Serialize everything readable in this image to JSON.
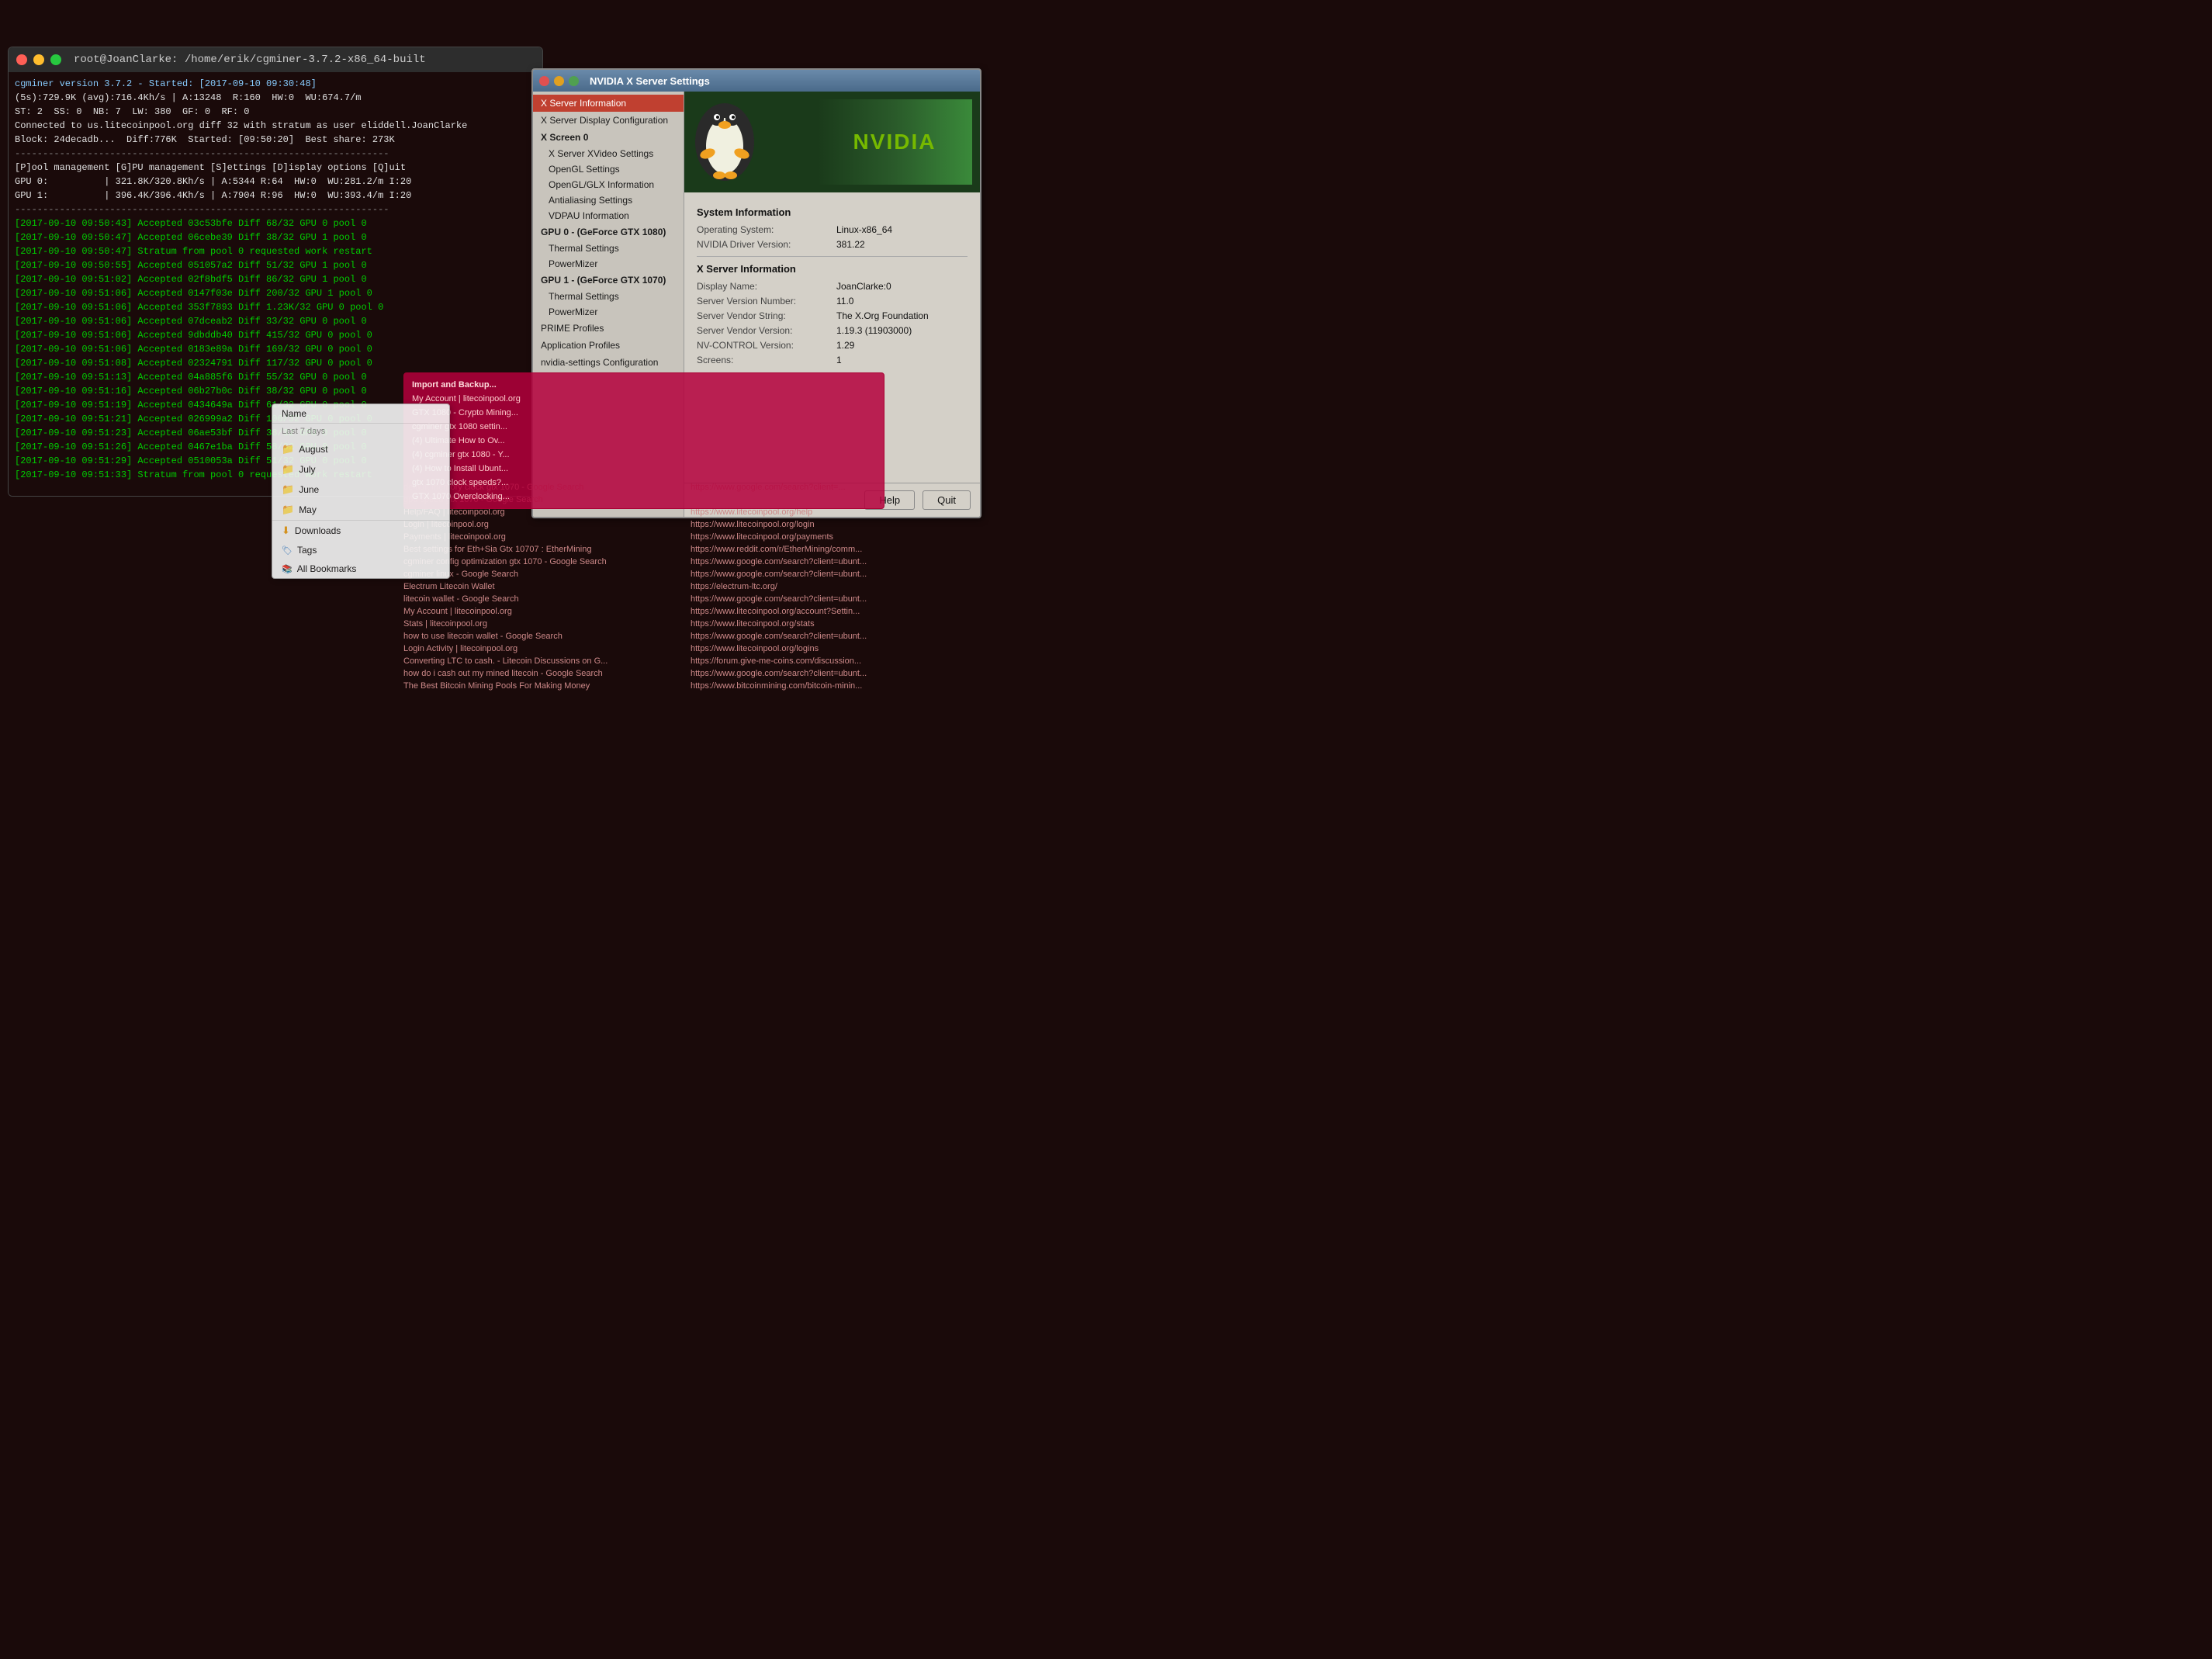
{
  "desktop": {
    "bg_color": "#1a0a0a"
  },
  "terminal": {
    "title": "root@JoanClarke: /home/erik/cgminer-3.7.2-x86_64-built",
    "lines": [
      "cgminer version 3.7.2 - Started: [2017-09-10 09:30:48]",
      "(5s):729.9K (avg):716.4Kh/s | A:13248  R:160  HW:0  WU:674.7/m",
      "ST: 2  SS: 0  NB: 7  LW: 380  GF: 0  RF: 0",
      "Connected to us.litecoinpool.org diff 32 with stratum as user eliddell.JoanClarke",
      "Block: 24decadb...  Diff:776K  Started: [09:50:20]  Best share: 273K",
      "-------------------------------------------------------------------",
      "[P]ool management [G]PU management [S]ettings [D]isplay options [Q]uit",
      "GPU 0:          | 321.8K/320.8Kh/s | A:5344 R:64  HW:0  WU:281.2/m I:20",
      "GPU 1:          | 396.4K/396.4Kh/s | A:7904 R:96  HW:0  WU:393.4/m I:20",
      "-------------------------------------------------------------------",
      "[2017-09-10 09:50:43] Accepted 03c53bfe Diff 68/32 GPU 0 pool 0",
      "[2017-09-10 09:50:47] Accepted 06cebe39 Diff 38/32 GPU 1 pool 0",
      "[2017-09-10 09:50:47] Stratum from pool 0 requested work restart",
      "[2017-09-10 09:50:55] Accepted 051057a2 Diff 51/32 GPU 1 pool 0",
      "[2017-09-10 09:51:02] Accepted 02f8bdf5 Diff 86/32 GPU 1 pool 0",
      "[2017-09-10 09:51:06] Accepted 0147f03e Diff 200/32 GPU 1 pool 0",
      "[2017-09-10 09:51:06] Accepted 353f7893 Diff 1.23K/32 GPU 0 pool 0",
      "[2017-09-10 09:51:06] Accepted 07dceab2 Diff 33/32 GPU 0 pool 0",
      "[2017-09-10 09:51:06] Accepted 9dbddb40 Diff 415/32 GPU 0 pool 0",
      "[2017-09-10 09:51:06] Accepted 0183e89a Diff 169/32 GPU 0 pool 0",
      "[2017-09-10 09:51:08] Accepted 02324791 Diff 117/32 GPU 0 pool 0",
      "[2017-09-10 09:51:13] Accepted 04a885f6 Diff 55/32 GPU 0 pool 0",
      "[2017-09-10 09:51:16] Accepted 06b27b0c Diff 38/32 GPU 0 pool 0",
      "[2017-09-10 09:51:19] Accepted 0434649a Diff 61/32 GPU 0 pool 0",
      "[2017-09-10 09:51:21] Accepted 026999a2 Diff 106/32 GPU 0 pool 0",
      "[2017-09-10 09:51:23] Accepted 06ae53bf Diff 38/32 GPU 0 pool 0",
      "[2017-09-10 09:51:26] Accepted 0467e1ba Diff 58/32 GPU 0 pool 0",
      "[2017-09-10 09:51:29] Accepted 0510053a Diff 51/32 GPU 0 pool 0",
      "[2017-09-10 09:51:33] Stratum from pool 0 requested work restart"
    ]
  },
  "nvidia_window": {
    "title": "NVIDIA X Server Settings",
    "sidebar": {
      "items": [
        {
          "id": "x-server-info",
          "label": "X Server Information",
          "active": true,
          "indent": 0
        },
        {
          "id": "x-server-display",
          "label": "X Server Display Configuration",
          "active": false,
          "indent": 0
        },
        {
          "id": "x-screen-0",
          "label": "X Screen 0",
          "active": false,
          "indent": 0
        },
        {
          "id": "x-video-settings",
          "label": "X Server XVideo Settings",
          "active": false,
          "indent": 1
        },
        {
          "id": "opengl-settings",
          "label": "OpenGL Settings",
          "active": false,
          "indent": 1
        },
        {
          "id": "opengl-glx-info",
          "label": "OpenGL/GLX Information",
          "active": false,
          "indent": 1
        },
        {
          "id": "antialiasing",
          "label": "Antialiasing Settings",
          "active": false,
          "indent": 1
        },
        {
          "id": "vdpau-info",
          "label": "VDPAU Information",
          "active": false,
          "indent": 1
        },
        {
          "id": "gpu0-section",
          "label": "GPU 0 - (GeForce GTX 1080)",
          "active": false,
          "indent": 0
        },
        {
          "id": "gpu0-thermal",
          "label": "Thermal Settings",
          "active": false,
          "indent": 1
        },
        {
          "id": "gpu0-powermizer",
          "label": "PowerMizer",
          "active": false,
          "indent": 1
        },
        {
          "id": "gpu1-section",
          "label": "GPU 1 - (GeForce GTX 1070)",
          "active": false,
          "indent": 0
        },
        {
          "id": "gpu1-thermal",
          "label": "Thermal Settings",
          "active": false,
          "indent": 1
        },
        {
          "id": "gpu1-powermizer",
          "label": "PowerMizer",
          "active": false,
          "indent": 1
        },
        {
          "id": "prime-profiles",
          "label": "PRIME Profiles",
          "active": false,
          "indent": 0
        },
        {
          "id": "app-profiles",
          "label": "Application Profiles",
          "active": false,
          "indent": 0
        },
        {
          "id": "nvidia-settings-config",
          "label": "nvidia-settings Configuration",
          "active": false,
          "indent": 0
        }
      ]
    },
    "content": {
      "system_info_title": "System Information",
      "os_label": "Operating System:",
      "os_value": "Linux-x86_64",
      "driver_label": "NVIDIA Driver Version:",
      "driver_value": "381.22",
      "xserver_info_title": "X Server Information",
      "display_name_label": "Display Name:",
      "display_name_value": "JoanClarke:0",
      "server_version_label": "Server Version Number:",
      "server_version_value": "11.0",
      "server_vendor_label": "Server Vendor String:",
      "server_vendor_value": "The X.Org Foundation",
      "server_vendor_version_label": "Server Vendor Version:",
      "server_vendor_version_value": "1.19.3 (11903000)",
      "nv_control_label": "NV-CONTROL Version:",
      "nv_control_value": "1.29",
      "screens_label": "Screens:",
      "screens_value": "1"
    },
    "buttons": {
      "help": "Help",
      "quit": "Quit"
    }
  },
  "bookmarks": {
    "title": "Name",
    "sections": [
      {
        "type": "section",
        "label": "Last 7 days"
      },
      {
        "type": "folder",
        "label": "August"
      },
      {
        "type": "folder",
        "label": "July"
      },
      {
        "type": "folder",
        "label": "June"
      },
      {
        "type": "folder",
        "label": "May"
      },
      {
        "type": "section",
        "label": "Downloads"
      },
      {
        "type": "item",
        "label": "Tags"
      },
      {
        "type": "item",
        "label": "All Bookmarks"
      }
    ]
  },
  "history_items": [
    {
      "title": "My Account | litecoinpool.org",
      "url": ""
    },
    {
      "title": "GTX 1080 - Crypto Mining...",
      "url": ""
    },
    {
      "title": "cgminer gtx 1080 settin...",
      "url": ""
    },
    {
      "title": "(4) Ultimate How to Ov...",
      "url": ""
    },
    {
      "title": "(4) cgminer gtx 1080 - Y...",
      "url": ""
    },
    {
      "title": "(4) How to Install Ubunt...",
      "url": ""
    },
    {
      "title": "gtx 1070 clock speeds?...",
      "url": ""
    },
    {
      "title": "GTX 1070 Overclocking...",
      "url": ""
    }
  ],
  "bottom_history": [
    {
      "title": "default memory clock gtx 1070 - Google Search",
      "url": "https://www.google.com/search?client=..."
    },
    {
      "title": "gpu speed gtx 1070 - Google Search",
      "url": ""
    },
    {
      "title": "Help/FAQ | litecoinpool.org",
      "url": "https://www.litecoinpool.org/help"
    },
    {
      "title": "Login | litecoinpool.org",
      "url": "https://www.litecoinpool.org/login"
    },
    {
      "title": "Payments | litecoinpool.org",
      "url": "https://www.litecoinpool.org/payments"
    },
    {
      "title": "Best settings for Eth+Sia Gtx 10707 : EtherMining",
      "url": "https://www.reddit.com/r/EtherMining/comm..."
    },
    {
      "title": "cgminer config optimization gtx 1070 - Google Search",
      "url": "https://www.google.com/search?client=ubunt..."
    },
    {
      "title": "cgminer linux - Google Search",
      "url": "https://www.google.com/search?client=ubunt..."
    },
    {
      "title": "Electrum Litecoin Wallet",
      "url": "https://electrum-ltc.org/"
    },
    {
      "title": "litecoin wallet - Google Search",
      "url": "https://www.google.com/search?client=ubunt..."
    },
    {
      "title": "My Account | litecoinpool.org",
      "url": "https://www.litecoinpool.org/account?Settin..."
    },
    {
      "title": "Stats | litecoinpool.org",
      "url": "https://www.litecoinpool.org/stats"
    },
    {
      "title": "how to use litecoin wallet - Google Search",
      "url": "https://www.google.com/search?client=ubunt..."
    },
    {
      "title": "Login Activity | litecoinpool.org",
      "url": "https://www.litecoinpool.org/logins"
    },
    {
      "title": "Converting LTC to cash. - Litecoin Discussions on G...",
      "url": "https://forum.give-me-coins.com/discussion..."
    },
    {
      "title": "how do i cash out my mined litecoin - Google Search",
      "url": "https://www.google.com/search?client=ubunt..."
    },
    {
      "title": "The Best Bitcoin Mining Pools For Making Money",
      "url": "https://www.bitcoinmining.com/bitcoin-minin..."
    }
  ]
}
